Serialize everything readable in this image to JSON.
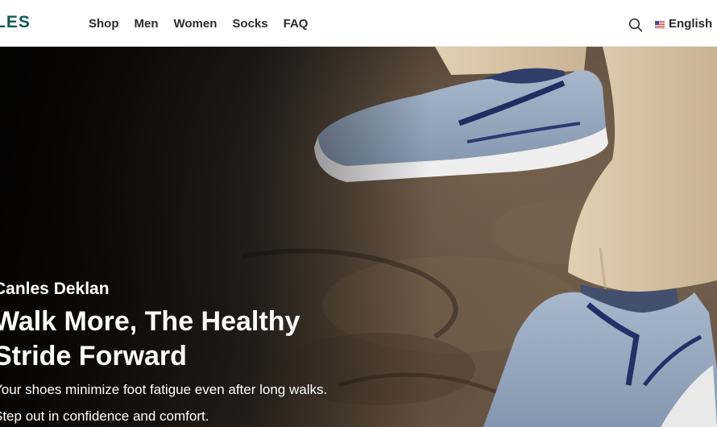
{
  "brand": {
    "logo_text": "LES"
  },
  "nav": {
    "items": [
      "Shop",
      "Men",
      "Women",
      "Socks",
      "FAQ"
    ]
  },
  "header": {
    "search_icon": "search-icon",
    "language": "English",
    "flag_icon": "us-flag-icon"
  },
  "hero": {
    "eyebrow": "Canles Deklan",
    "headline": "Walk More, The Healthy Stride Forward",
    "line1": "Your shoes minimize foot fatigue even after long walks.",
    "line2": "Step out in confidence and comfort."
  },
  "colors": {
    "brand": "#0f5a55",
    "nav_text": "#2b2b2b",
    "hero_text": "#ffffff"
  }
}
